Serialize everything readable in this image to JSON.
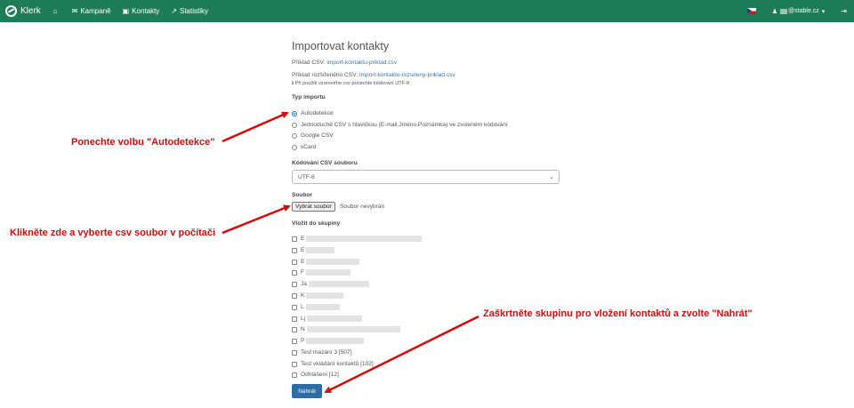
{
  "navbar": {
    "brand": "Klerk",
    "items": [
      {
        "icon": "home-icon",
        "glyph": "⌂",
        "label": ""
      },
      {
        "icon": "mail-icon",
        "glyph": "✉",
        "label": "Kampaně"
      },
      {
        "icon": "contact-book-icon",
        "glyph": "▣",
        "label": "Kontakty"
      },
      {
        "icon": "chart-icon",
        "glyph": "↗",
        "label": "Statistiky"
      }
    ],
    "user_domain": "@stable.cz",
    "user_caret": "▾",
    "logout_glyph": "⇥",
    "user_glyph": "♟"
  },
  "page": {
    "title": "Importovat kontakty",
    "example_label": "Příklad CSV:",
    "example_link": "import-kontaktu-priklad.csv",
    "example_ext_label": "Příklad rozšířeného CSV:",
    "example_ext_link": "import-kontaktu-rozsireny-priklad.csv",
    "utf_note": "ℹ Při použití vzorového csv ponechte kódování UTF-8",
    "type_label": "Typ importu",
    "type_options": [
      "Autodetekce",
      "Jednoduché CSV s hlavičkou (E-mail,Jméno,Poznámka) ve zvoleném kódování",
      "Google CSV",
      "vCard"
    ],
    "type_selected_index": 0,
    "encoding_label": "Kódování CSV souboru",
    "encoding_value": "UTF-8",
    "file_label": "Soubor",
    "file_button": "Vybrat soubor",
    "file_none": "Soubor nevybrán",
    "groups_label": "Vložit do skupiny",
    "groups": [
      "E",
      "E",
      "E",
      "F",
      "Ja",
      "K",
      "L",
      "Lj",
      "N",
      "P",
      "Test mazání 3 [507]",
      "Test vkládání kontaktů [102]",
      "Odhlášení [12]"
    ],
    "upload_button": "Nahrát"
  },
  "annotations": {
    "autodetect": "Ponechte volbu \"Autodetekce\"",
    "file": "Klikněte zde a vyberte csv soubor v počítači",
    "group": "Zaškrtněte skupinu pro vložení kontaktů a zvolte \"Nahrát\""
  },
  "colors": {
    "navbar": "#1d7d59",
    "annotation": "#d80a0a",
    "button": "#2e6da4"
  }
}
